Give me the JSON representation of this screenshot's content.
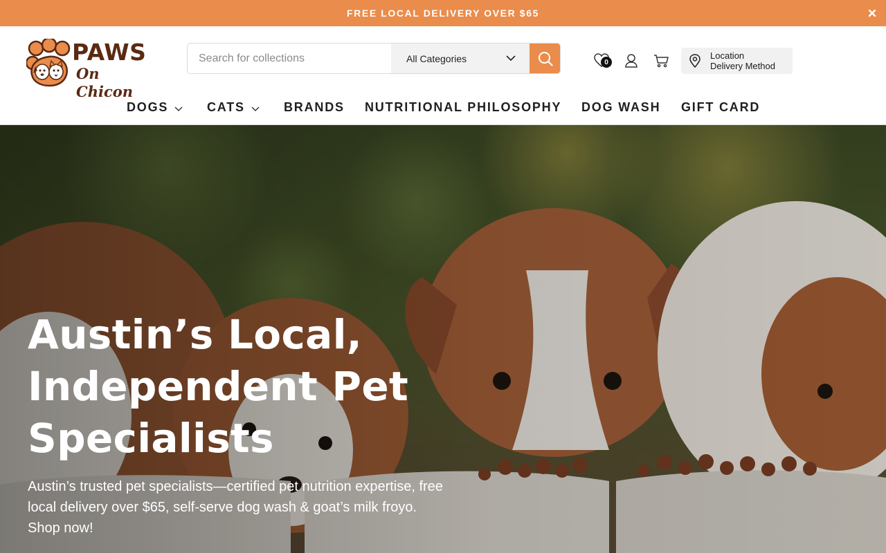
{
  "announcement": {
    "text": "FREE LOCAL DELIVERY OVER $65",
    "close_icon": "close-icon",
    "bg_color": "#ea8c4b"
  },
  "header": {
    "logo": {
      "line1": "PAWS",
      "line2": "On Chicon"
    },
    "search": {
      "placeholder": "Search for collections",
      "value": "",
      "category": "All Categories",
      "button_icon": "search-icon"
    },
    "wishlist": {
      "icon": "heart-icon",
      "count": "0"
    },
    "account": {
      "icon": "user-icon"
    },
    "cart": {
      "icon": "cart-icon"
    },
    "location": {
      "line1": "Location",
      "line2": "Delivery Method",
      "icon": "map-pin-icon"
    }
  },
  "nav": {
    "items": [
      {
        "label": "DOGS",
        "has_dropdown": true
      },
      {
        "label": "CATS",
        "has_dropdown": true
      },
      {
        "label": "BRANDS",
        "has_dropdown": false
      },
      {
        "label": "NUTRITIONAL PHILOSOPHY",
        "has_dropdown": false
      },
      {
        "label": "DOG WASH",
        "has_dropdown": false
      },
      {
        "label": "GIFT CARD",
        "has_dropdown": false
      }
    ]
  },
  "hero": {
    "title": "Austin’s Local, Independent Pet Specialists",
    "subtitle": "Austin’s trusted pet specialists—certified pet nutrition expertise, free local delivery over $65, self-serve dog wash & goat’s milk froyo. Shop now!"
  },
  "colors": {
    "accent": "#ea8c4b",
    "brand_brown": "#5b2a12"
  }
}
